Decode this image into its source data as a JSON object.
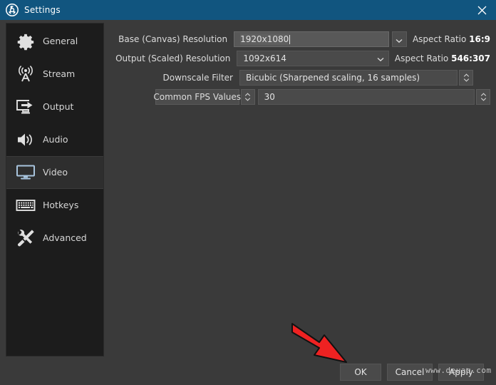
{
  "window": {
    "title": "Settings",
    "logo_icon": "obs-logo-icon",
    "close_icon": "close-icon",
    "titlebar_color": "#11557f"
  },
  "sidebar": {
    "items": [
      {
        "id": "general",
        "label": "General",
        "icon": "gear-icon",
        "selected": false
      },
      {
        "id": "stream",
        "label": "Stream",
        "icon": "broadcast-icon",
        "selected": false
      },
      {
        "id": "output",
        "label": "Output",
        "icon": "monitor-arrow-icon",
        "selected": false
      },
      {
        "id": "audio",
        "label": "Audio",
        "icon": "speaker-icon",
        "selected": false
      },
      {
        "id": "video",
        "label": "Video",
        "icon": "monitor-icon",
        "selected": true
      },
      {
        "id": "hotkeys",
        "label": "Hotkeys",
        "icon": "keyboard-icon",
        "selected": false
      },
      {
        "id": "advanced",
        "label": "Advanced",
        "icon": "tools-icon",
        "selected": false
      }
    ],
    "selected_accent_color": "#a8c4dd"
  },
  "video_settings": {
    "base_resolution": {
      "label": "Base (Canvas) Resolution",
      "value": "1920x1080",
      "dropdown_icon": "chevron-down-icon",
      "aspect_label": "Aspect Ratio",
      "aspect_value": "16:9"
    },
    "output_resolution": {
      "label": "Output (Scaled) Resolution",
      "value": "1092x614",
      "dropdown_icon": "chevron-down-icon",
      "aspect_label": "Aspect Ratio",
      "aspect_value": "546:307"
    },
    "downscale_filter": {
      "label": "Downscale Filter",
      "value": "Bicubic (Sharpened scaling, 16 samples)",
      "spinner_icon": "spinner-updown-icon"
    },
    "fps": {
      "mode_label": "Common FPS Values",
      "mode_spinner_icon": "spinner-updown-icon",
      "value": "30",
      "value_spinner_icon": "spinner-updown-icon"
    }
  },
  "footer": {
    "ok_label": "OK",
    "cancel_label": "Cancel",
    "apply_label": "Apply"
  },
  "annotation": {
    "arrow_icon": "red-arrow-icon",
    "arrow_color": "#ee2222",
    "target": "OK"
  },
  "watermark": {
    "text": "www.deuaq.com"
  }
}
